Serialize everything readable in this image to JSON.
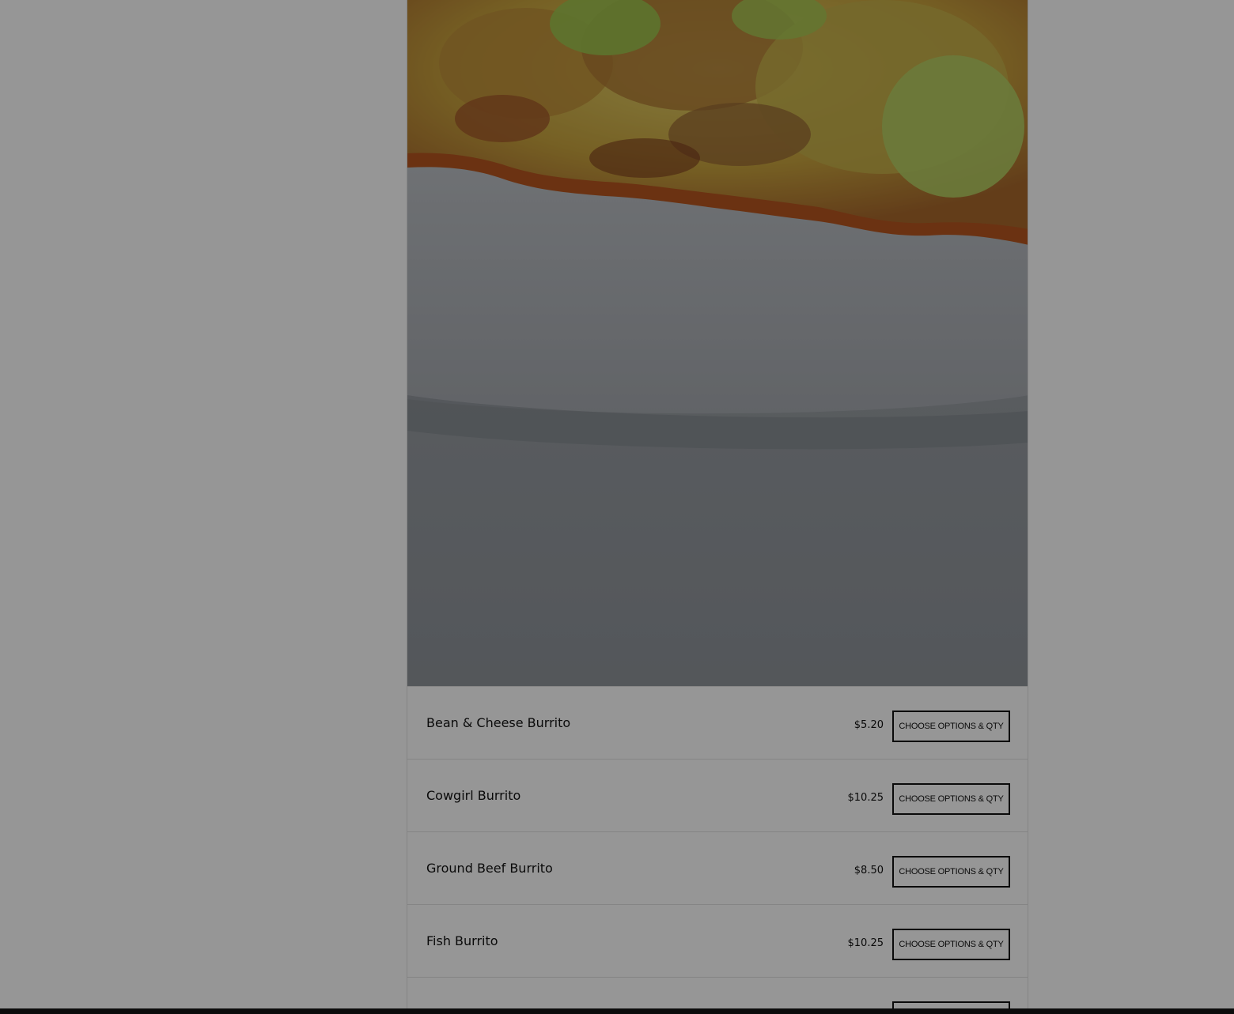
{
  "menu": {
    "items": [
      {
        "name": "Bean & Cheese Burrito",
        "price": "$5.20",
        "button_label": "CHOOSE OPTIONS & QTY"
      },
      {
        "name": "Cowgirl Burrito",
        "price": "$10.25",
        "button_label": "CHOOSE OPTIONS & QTY"
      },
      {
        "name": "Ground Beef Burrito",
        "price": "$8.50",
        "button_label": "CHOOSE OPTIONS & QTY"
      },
      {
        "name": "Fish Burrito",
        "price": "$10.25",
        "button_label": "CHOOSE OPTIONS & QTY"
      },
      {
        "name": "",
        "price": "",
        "button_label": ""
      }
    ]
  },
  "hero": {
    "image_icon": "food-photo-icon"
  },
  "colors": {
    "overlay": "#000000",
    "overlay_opacity": 0.41,
    "button_border": "#111111",
    "divider": "#e2e2e2"
  }
}
